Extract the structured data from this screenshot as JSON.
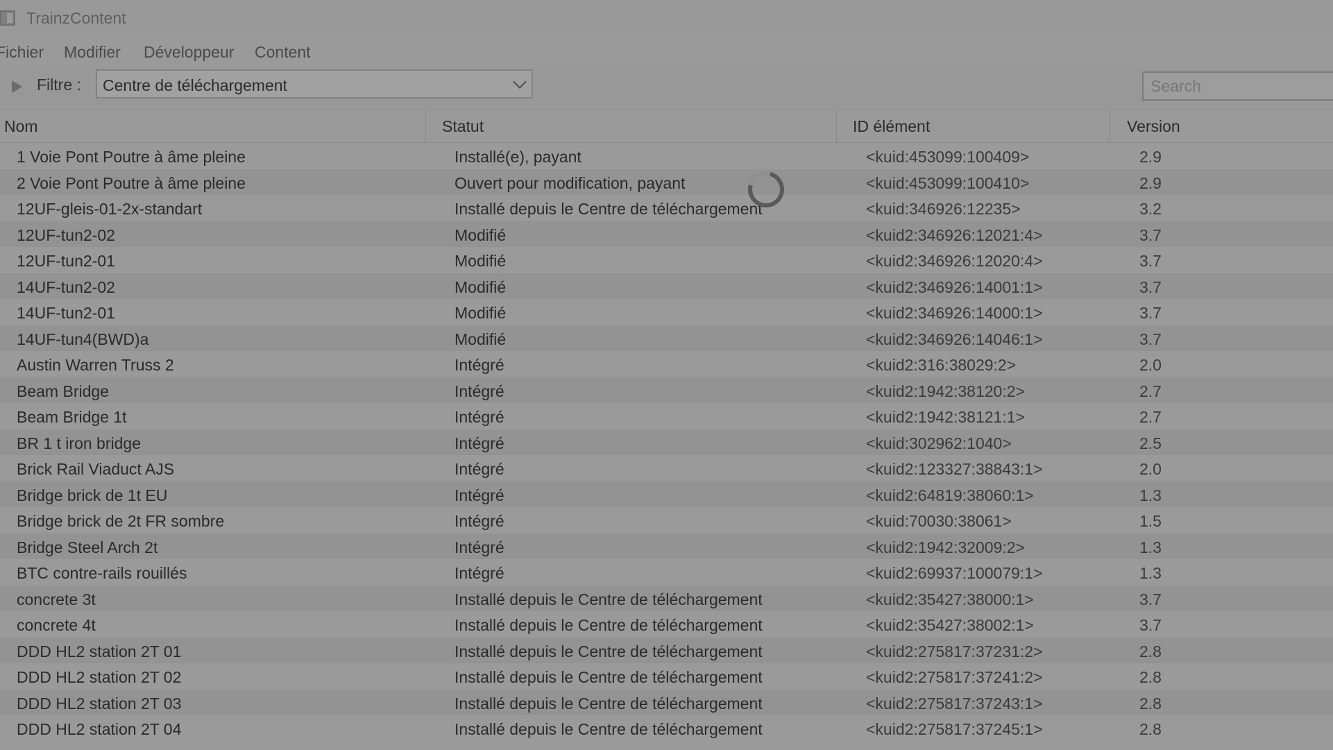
{
  "window": {
    "title": "TrainzContent"
  },
  "menu": {
    "items": [
      "Fichier",
      "Modifier",
      "Développeur",
      "Content"
    ]
  },
  "toolbar": {
    "filter_label": "Filtre :",
    "filter_value": "Centre de téléchargement",
    "search_placeholder": "Search",
    "icons": [
      "play-icon",
      "chevron-down-icon"
    ]
  },
  "table": {
    "columns": [
      "Nom",
      "Statut",
      "ID élément",
      "Version"
    ],
    "rows": [
      {
        "name": "1 Voie Pont Poutre à âme pleine",
        "status": "Installé(e), payant",
        "kuid": "<kuid:453099:100409>",
        "version": "2.9"
      },
      {
        "name": "2 Voie Pont Poutre à âme pleine",
        "status": "Ouvert pour modification, payant",
        "kuid": "<kuid:453099:100410>",
        "version": "2.9"
      },
      {
        "name": "12UF-gleis-01-2x-standart",
        "status": "Installé depuis le Centre de téléchargement",
        "kuid": "<kuid:346926:12235>",
        "version": "3.2"
      },
      {
        "name": "12UF-tun2-02",
        "status": "Modifié",
        "kuid": "<kuid2:346926:12021:4>",
        "version": "3.7"
      },
      {
        "name": "12UF-tun2-01",
        "status": "Modifié",
        "kuid": "<kuid2:346926:12020:4>",
        "version": "3.7"
      },
      {
        "name": "14UF-tun2-02",
        "status": "Modifié",
        "kuid": "<kuid2:346926:14001:1>",
        "version": "3.7"
      },
      {
        "name": "14UF-tun2-01",
        "status": "Modifié",
        "kuid": "<kuid2:346926:14000:1>",
        "version": "3.7"
      },
      {
        "name": "14UF-tun4(BWD)a",
        "status": "Modifié",
        "kuid": "<kuid2:346926:14046:1>",
        "version": "3.7"
      },
      {
        "name": "Austin Warren Truss 2",
        "status": "Intégré",
        "kuid": "<kuid2:316:38029:2>",
        "version": "2.0"
      },
      {
        "name": "Beam Bridge",
        "status": "Intégré",
        "kuid": "<kuid2:1942:38120:2>",
        "version": "2.7"
      },
      {
        "name": "Beam Bridge 1t",
        "status": "Intégré",
        "kuid": "<kuid2:1942:38121:1>",
        "version": "2.7"
      },
      {
        "name": "BR 1 t iron bridge",
        "status": "Intégré",
        "kuid": "<kuid:302962:1040>",
        "version": "2.5"
      },
      {
        "name": "Brick Rail Viaduct AJS",
        "status": "Intégré",
        "kuid": "<kuid2:123327:38843:1>",
        "version": "2.0"
      },
      {
        "name": "Bridge brick de 1t EU",
        "status": "Intégré",
        "kuid": "<kuid2:64819:38060:1>",
        "version": "1.3"
      },
      {
        "name": "Bridge brick de 2t FR sombre",
        "status": "Intégré",
        "kuid": "<kuid:70030:38061>",
        "version": "1.5"
      },
      {
        "name": "Bridge Steel Arch 2t",
        "status": "Intégré",
        "kuid": "<kuid2:1942:32009:2>",
        "version": "1.3"
      },
      {
        "name": "BTC contre-rails rouillés",
        "status": "Intégré",
        "kuid": "<kuid2:69937:100079:1>",
        "version": "1.3"
      },
      {
        "name": "concrete 3t",
        "status": "Installé depuis le Centre de téléchargement",
        "kuid": "<kuid2:35427:38000:1>",
        "version": "3.7"
      },
      {
        "name": "concrete 4t",
        "status": "Installé depuis le Centre de téléchargement",
        "kuid": "<kuid2:35427:38002:1>",
        "version": "3.7"
      },
      {
        "name": "DDD HL2 station 2T 01",
        "status": "Installé depuis le Centre de téléchargement",
        "kuid": "<kuid2:275817:37231:2>",
        "version": "2.8"
      },
      {
        "name": "DDD HL2 station 2T 02",
        "status": "Installé depuis le Centre de téléchargement",
        "kuid": "<kuid2:275817:37241:2>",
        "version": "2.8"
      },
      {
        "name": "DDD HL2 station 2T 03",
        "status": "Installé depuis le Centre de téléchargement",
        "kuid": "<kuid2:275817:37243:1>",
        "version": "2.8"
      },
      {
        "name": "DDD HL2 station 2T 04",
        "status": "Installé depuis le Centre de téléchargement",
        "kuid": "<kuid2:275817:37245:1>",
        "version": "2.8"
      }
    ]
  },
  "loading": {
    "icon": "loading-spinner-icon"
  }
}
